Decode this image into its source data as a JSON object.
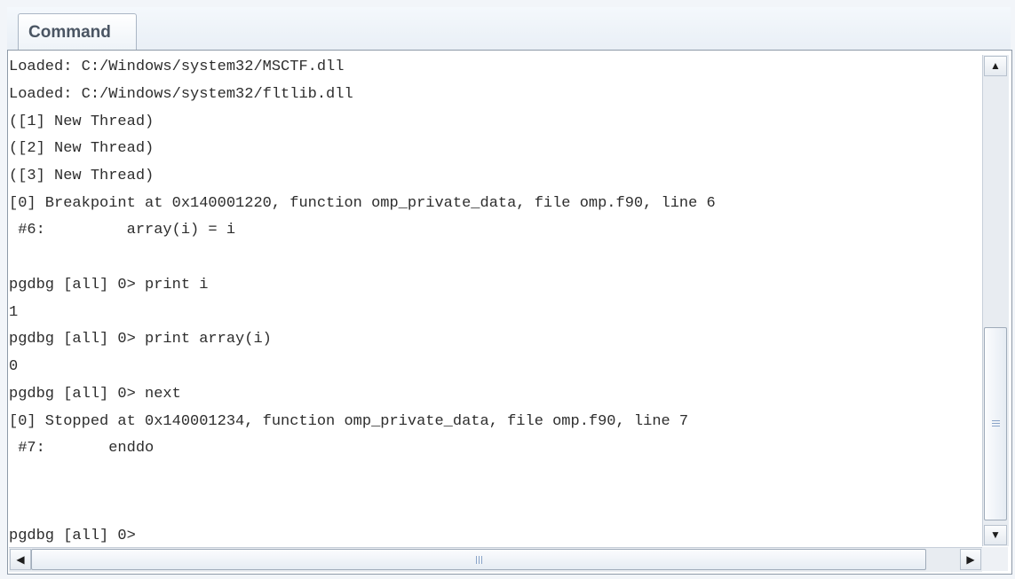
{
  "panel": {
    "tab_label": "Command"
  },
  "console": {
    "lines": [
      "Loaded: C:/Windows/system32/MSCTF.dll",
      "Loaded: C:/Windows/system32/fltlib.dll",
      "([1] New Thread)",
      "([2] New Thread)",
      "([3] New Thread)",
      "[0] Breakpoint at 0x140001220, function omp_private_data, file omp.f90, line 6",
      " #6:         array(i) = i",
      "",
      "pgdbg [all] 0> print i",
      "1",
      "pgdbg [all] 0> print array(i)",
      "0",
      "pgdbg [all] 0> next",
      "[0] Stopped at 0x140001234, function omp_private_data, file omp.f90, line 7",
      " #7:       enddo",
      "",
      "pgdbg [all] 0>"
    ]
  },
  "scrollbars": {
    "up_icon": "arrow-up-icon",
    "down_icon": "arrow-down-icon",
    "left_icon": "arrow-left-icon",
    "right_icon": "arrow-right-icon",
    "vertical_position": 0.6,
    "horizontal_position": 0.0
  },
  "colors": {
    "text": "#2d2d2d",
    "tab_text": "#4a5563",
    "border": "#8e9aa8",
    "background": "#ffffff"
  }
}
